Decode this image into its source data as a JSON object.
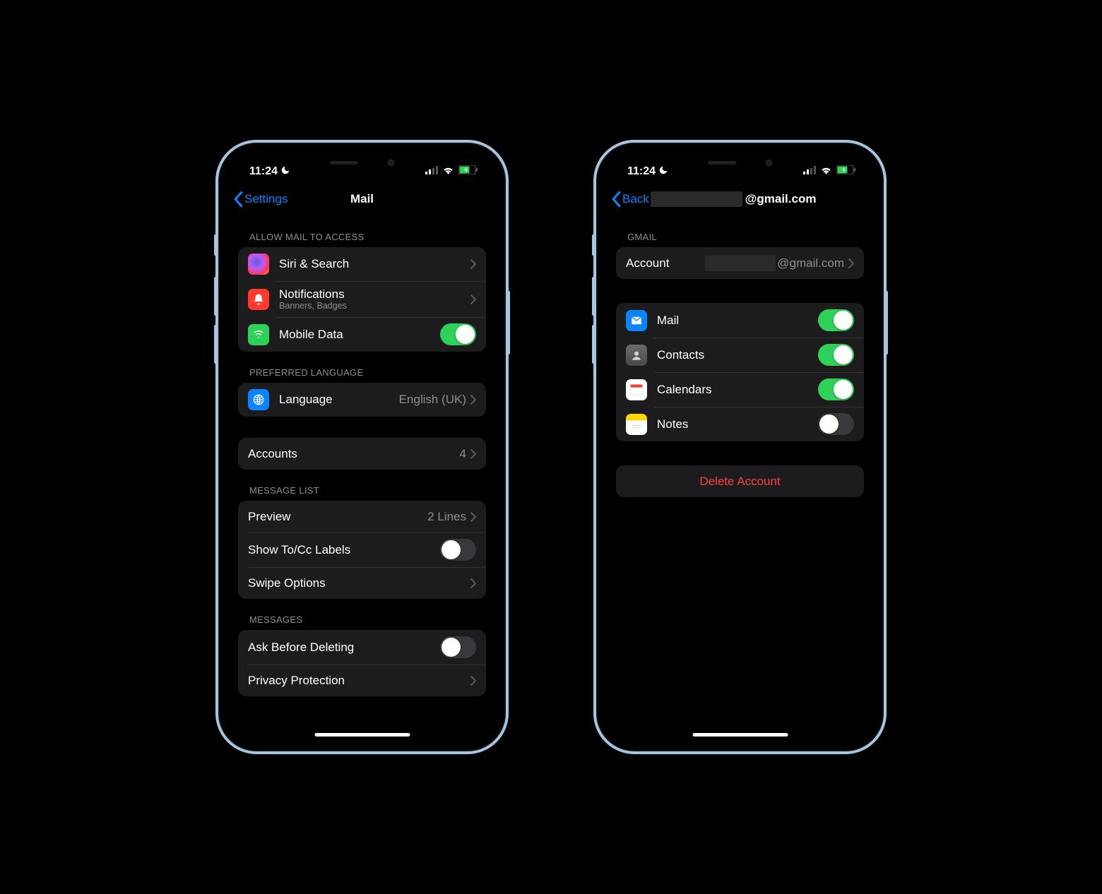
{
  "status": {
    "time": "11:24"
  },
  "left_screen": {
    "nav": {
      "back": "Settings",
      "title": "Mail"
    },
    "sections": {
      "allow_access": {
        "header": "Allow Mail to Access",
        "siri": {
          "label": "Siri & Search"
        },
        "notifications": {
          "label": "Notifications",
          "sub": "Banners, Badges"
        },
        "mobile_data": {
          "label": "Mobile Data",
          "toggle": true
        }
      },
      "preferred_language": {
        "header": "Preferred Language",
        "language": {
          "label": "Language",
          "value": "English (UK)"
        }
      },
      "accounts": {
        "row": {
          "label": "Accounts",
          "value": "4"
        }
      },
      "message_list": {
        "header": "Message List",
        "preview": {
          "label": "Preview",
          "value": "2 Lines"
        },
        "show_tocc": {
          "label": "Show To/Cc Labels",
          "toggle": false
        },
        "swipe_options": {
          "label": "Swipe Options"
        }
      },
      "messages": {
        "header": "Messages",
        "ask_before_deleting": {
          "label": "Ask Before Deleting",
          "toggle": false
        },
        "privacy_protection": {
          "label": "Privacy Protection"
        }
      }
    }
  },
  "right_screen": {
    "nav": {
      "back": "Back",
      "title_suffix": "@gmail.com"
    },
    "sections": {
      "gmail": {
        "header": "Gmail",
        "account": {
          "label": "Account",
          "value_suffix": "@gmail.com"
        }
      },
      "services": {
        "mail": {
          "label": "Mail",
          "toggle": true
        },
        "contacts": {
          "label": "Contacts",
          "toggle": true
        },
        "calendars": {
          "label": "Calendars",
          "toggle": true
        },
        "notes": {
          "label": "Notes",
          "toggle": false
        }
      },
      "delete": {
        "label": "Delete Account"
      }
    }
  }
}
